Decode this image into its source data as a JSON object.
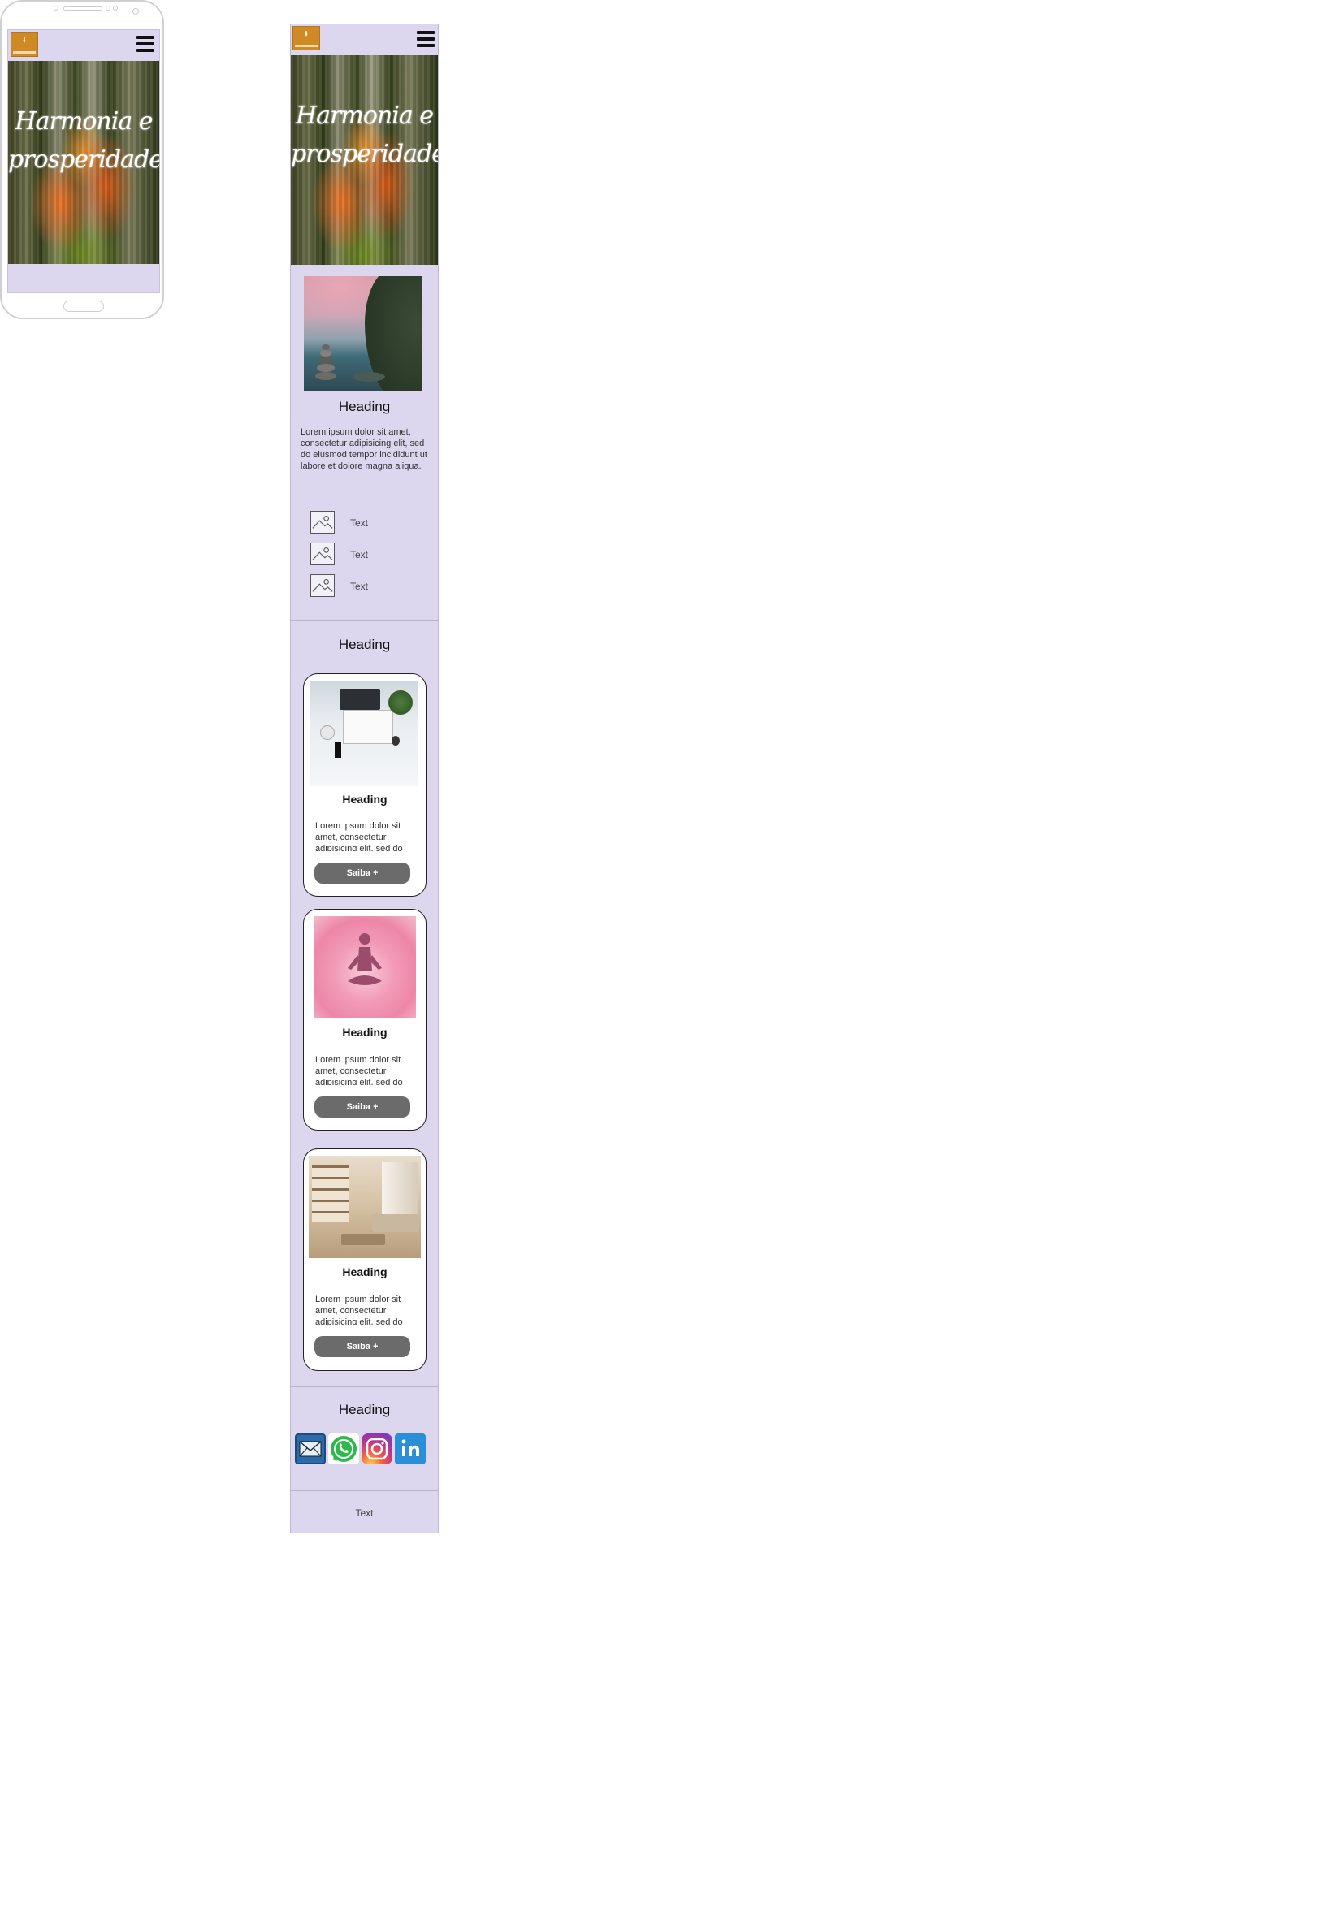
{
  "hero": {
    "title_line1": "Harmonia e",
    "title_line2": "prosperidade"
  },
  "about": {
    "heading": "Heading",
    "paragraph": "Lorem ipsum dolor sit amet, consectetur adipisicing elit, sed do eiusmod tempor incididunt ut labore et dolore magna aliqua.",
    "features": [
      {
        "text": "Text",
        "icon": "image-placeholder-icon"
      },
      {
        "text": "Text",
        "icon": "image-placeholder-icon"
      },
      {
        "text": "Text",
        "icon": "image-placeholder-icon"
      }
    ]
  },
  "services": {
    "heading": "Heading",
    "cards": [
      {
        "heading": "Heading",
        "text": "Lorem ipsum dolor sit amet, consectetur adipisicing elit, sed do",
        "button": "Saiba +"
      },
      {
        "heading": "Heading",
        "text": "Lorem ipsum dolor sit amet, consectetur adipisicing elit, sed do",
        "button": "Saiba +"
      },
      {
        "heading": "Heading",
        "text": "Lorem ipsum dolor sit amet, consectetur adipisicing elit, sed do",
        "button": "Saiba +"
      }
    ]
  },
  "contact": {
    "heading": "Heading",
    "social": [
      "mail-icon",
      "whatsapp-icon",
      "instagram-icon",
      "linkedin-icon"
    ]
  },
  "footer": {
    "text": "Text"
  },
  "colors": {
    "page_background": "#dcd6ee",
    "logo_background": "#cf8a26",
    "button_background": "#6b6b6b"
  }
}
